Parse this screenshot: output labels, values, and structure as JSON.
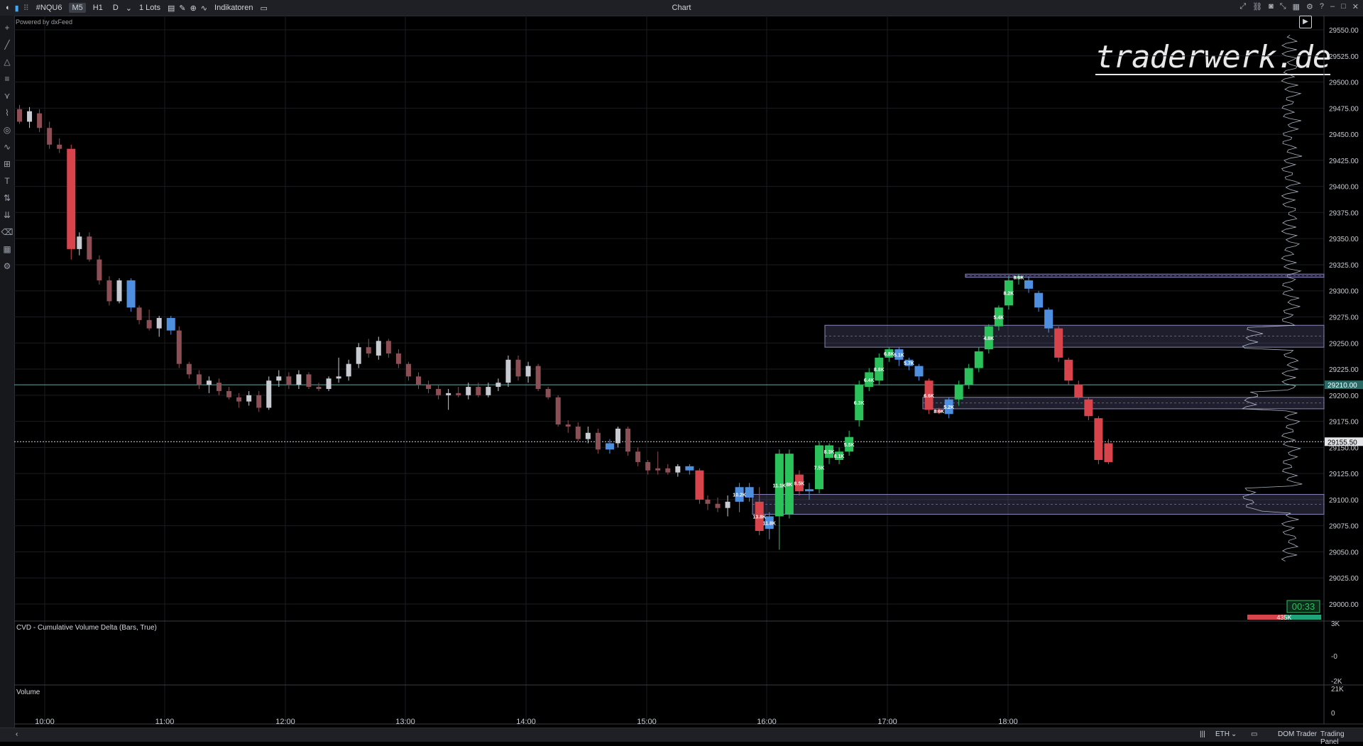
{
  "toolbar": {
    "symbol": "#NQU6",
    "timeframes": [
      "M5",
      "H1",
      "D"
    ],
    "active_timeframe": "M5",
    "lots": "1 Lots",
    "indicators": "Indikatoren",
    "title": "Chart"
  },
  "powered_by": "Powered by dxFeed",
  "watermark": "traderwerk.de",
  "price_axis": {
    "ticks": [
      "29550.00",
      "29525.00",
      "29500.00",
      "29475.00",
      "29450.00",
      "29425.00",
      "29400.00",
      "29375.00",
      "29350.00",
      "29325.00",
      "29300.00",
      "29275.00",
      "29250.00",
      "29225.00",
      "29200.00",
      "29175.00",
      "29150.00",
      "29125.00",
      "29100.00",
      "29075.00",
      "29050.00",
      "29025.00",
      "29000.00"
    ],
    "last_price": "29155.50",
    "marked_price": "29210.00",
    "timer": "00:33",
    "volume_tag": "435K"
  },
  "time_axis": [
    "10:00",
    "11:00",
    "12:00",
    "13:00",
    "14:00",
    "15:00",
    "16:00",
    "17:00",
    "18:00"
  ],
  "cvd_panel": {
    "label": "CVD - Cumulative Volume Delta (Bars, True)",
    "ticks": [
      "3K",
      "-0",
      "-2K"
    ]
  },
  "volume_panel": {
    "label": "Volume",
    "ticks": [
      "21K",
      "0"
    ]
  },
  "bottom_bar": {
    "session": "ETH",
    "dom_trader": "DOM Trader",
    "trading_panel": "Trading Panel"
  },
  "colors": {
    "bull": "#2bc25b",
    "bear": "#d8444b",
    "blue": "#4f8fe0",
    "gray_bull": "#c8ccd2",
    "gray_bear": "#8b4f55",
    "zone": "#6a6690"
  },
  "chart_data": {
    "type": "candlestick",
    "y_range": [
      29000,
      29560
    ],
    "zones": [
      {
        "top": 29316,
        "bottom": 29313
      },
      {
        "top": 29267,
        "bottom": 29246
      },
      {
        "top": 29198,
        "bottom": 29187
      },
      {
        "top": 29105,
        "bottom": 29086
      }
    ],
    "cluster_labels": [
      "8.2K",
      "5.4K",
      "4.8K",
      "8.6K",
      "6.3K",
      "5.5K",
      "5.1K",
      "6.4K",
      "5.2K",
      "6.8K",
      "5.7K",
      "6.6K",
      "8.6K",
      "10.2K",
      "11.1K",
      "8K",
      "8.5K",
      "13.8K",
      "11.8K",
      "8.1K",
      "8.3K",
      "7.5K",
      "8.8K"
    ],
    "candles": [
      {
        "o": 29474,
        "h": 29478,
        "l": 29460,
        "c": 29462,
        "k": "gb"
      },
      {
        "o": 29462,
        "h": 29476,
        "l": 29456,
        "c": 29472,
        "k": "gu"
      },
      {
        "o": 29470,
        "h": 29474,
        "l": 29452,
        "c": 29456,
        "k": "gb"
      },
      {
        "o": 29456,
        "h": 29462,
        "l": 29436,
        "c": 29440,
        "k": "gb"
      },
      {
        "o": 29440,
        "h": 29446,
        "l": 29432,
        "c": 29436,
        "k": "gb"
      },
      {
        "o": 29436,
        "h": 29440,
        "l": 29330,
        "c": 29340,
        "k": "r"
      },
      {
        "o": 29340,
        "h": 29356,
        "l": 29334,
        "c": 29352,
        "k": "gu"
      },
      {
        "o": 29352,
        "h": 29356,
        "l": 29328,
        "c": 29330,
        "k": "gb"
      },
      {
        "o": 29330,
        "h": 29334,
        "l": 29306,
        "c": 29310,
        "k": "gb"
      },
      {
        "o": 29310,
        "h": 29314,
        "l": 29286,
        "c": 29290,
        "k": "gb"
      },
      {
        "o": 29290,
        "h": 29312,
        "l": 29288,
        "c": 29310,
        "k": "gu"
      },
      {
        "o": 29310,
        "h": 29312,
        "l": 29280,
        "c": 29284,
        "k": "b"
      },
      {
        "o": 29284,
        "h": 29286,
        "l": 29268,
        "c": 29272,
        "k": "gb"
      },
      {
        "o": 29272,
        "h": 29282,
        "l": 29262,
        "c": 29264,
        "k": "gb"
      },
      {
        "o": 29264,
        "h": 29276,
        "l": 29256,
        "c": 29274,
        "k": "gu"
      },
      {
        "o": 29274,
        "h": 29276,
        "l": 29258,
        "c": 29262,
        "k": "b"
      },
      {
        "o": 29262,
        "h": 29266,
        "l": 29226,
        "c": 29230,
        "k": "gb"
      },
      {
        "o": 29230,
        "h": 29232,
        "l": 29216,
        "c": 29220,
        "k": "gb"
      },
      {
        "o": 29220,
        "h": 29224,
        "l": 29206,
        "c": 29210,
        "k": "gb"
      },
      {
        "o": 29210,
        "h": 29218,
        "l": 29202,
        "c": 29214,
        "k": "gu"
      },
      {
        "o": 29212,
        "h": 29216,
        "l": 29200,
        "c": 29204,
        "k": "gb"
      },
      {
        "o": 29204,
        "h": 29208,
        "l": 29196,
        "c": 29198,
        "k": "gb"
      },
      {
        "o": 29198,
        "h": 29202,
        "l": 29188,
        "c": 29194,
        "k": "gb"
      },
      {
        "o": 29194,
        "h": 29204,
        "l": 29190,
        "c": 29200,
        "k": "gu"
      },
      {
        "o": 29200,
        "h": 29204,
        "l": 29184,
        "c": 29188,
        "k": "gb"
      },
      {
        "o": 29188,
        "h": 29218,
        "l": 29186,
        "c": 29214,
        "k": "gu"
      },
      {
        "o": 29214,
        "h": 29224,
        "l": 29208,
        "c": 29218,
        "k": "gu"
      },
      {
        "o": 29218,
        "h": 29222,
        "l": 29206,
        "c": 29210,
        "k": "gb"
      },
      {
        "o": 29210,
        "h": 29224,
        "l": 29206,
        "c": 29220,
        "k": "gu"
      },
      {
        "o": 29220,
        "h": 29222,
        "l": 29206,
        "c": 29208,
        "k": "gb"
      },
      {
        "o": 29208,
        "h": 29212,
        "l": 29204,
        "c": 29206,
        "k": "gb"
      },
      {
        "o": 29206,
        "h": 29218,
        "l": 29204,
        "c": 29216,
        "k": "gu"
      },
      {
        "o": 29216,
        "h": 29236,
        "l": 29212,
        "c": 29218,
        "k": "gu"
      },
      {
        "o": 29218,
        "h": 29234,
        "l": 29214,
        "c": 29230,
        "k": "gu"
      },
      {
        "o": 29230,
        "h": 29250,
        "l": 29226,
        "c": 29246,
        "k": "gu"
      },
      {
        "o": 29246,
        "h": 29254,
        "l": 29236,
        "c": 29240,
        "k": "gb"
      },
      {
        "o": 29238,
        "h": 29256,
        "l": 29234,
        "c": 29252,
        "k": "gu"
      },
      {
        "o": 29252,
        "h": 29254,
        "l": 29236,
        "c": 29240,
        "k": "gb"
      },
      {
        "o": 29240,
        "h": 29244,
        "l": 29226,
        "c": 29230,
        "k": "gb"
      },
      {
        "o": 29230,
        "h": 29232,
        "l": 29214,
        "c": 29218,
        "k": "gb"
      },
      {
        "o": 29218,
        "h": 29222,
        "l": 29206,
        "c": 29210,
        "k": "gb"
      },
      {
        "o": 29210,
        "h": 29214,
        "l": 29202,
        "c": 29206,
        "k": "gb"
      },
      {
        "o": 29206,
        "h": 29210,
        "l": 29196,
        "c": 29200,
        "k": "gb"
      },
      {
        "o": 29200,
        "h": 29206,
        "l": 29186,
        "c": 29202,
        "k": "gu"
      },
      {
        "o": 29202,
        "h": 29208,
        "l": 29198,
        "c": 29200,
        "k": "gb"
      },
      {
        "o": 29200,
        "h": 29212,
        "l": 29196,
        "c": 29208,
        "k": "gu"
      },
      {
        "o": 29208,
        "h": 29212,
        "l": 29198,
        "c": 29200,
        "k": "gb"
      },
      {
        "o": 29200,
        "h": 29212,
        "l": 29198,
        "c": 29208,
        "k": "gu"
      },
      {
        "o": 29208,
        "h": 29216,
        "l": 29204,
        "c": 29212,
        "k": "gu"
      },
      {
        "o": 29212,
        "h": 29238,
        "l": 29208,
        "c": 29234,
        "k": "gu"
      },
      {
        "o": 29234,
        "h": 29238,
        "l": 29214,
        "c": 29218,
        "k": "gb"
      },
      {
        "o": 29218,
        "h": 29232,
        "l": 29212,
        "c": 29228,
        "k": "gu"
      },
      {
        "o": 29228,
        "h": 29230,
        "l": 29204,
        "c": 29206,
        "k": "gb"
      },
      {
        "o": 29206,
        "h": 29208,
        "l": 29196,
        "c": 29198,
        "k": "gb"
      },
      {
        "o": 29198,
        "h": 29200,
        "l": 29170,
        "c": 29172,
        "k": "gb"
      },
      {
        "o": 29172,
        "h": 29176,
        "l": 29164,
        "c": 29170,
        "k": "gb"
      },
      {
        "o": 29170,
        "h": 29174,
        "l": 29156,
        "c": 29158,
        "k": "gb"
      },
      {
        "o": 29158,
        "h": 29170,
        "l": 29154,
        "c": 29164,
        "k": "gu"
      },
      {
        "o": 29164,
        "h": 29168,
        "l": 29144,
        "c": 29148,
        "k": "gb"
      },
      {
        "o": 29148,
        "h": 29158,
        "l": 29144,
        "c": 29154,
        "k": "b"
      },
      {
        "o": 29154,
        "h": 29170,
        "l": 29150,
        "c": 29168,
        "k": "gu"
      },
      {
        "o": 29168,
        "h": 29170,
        "l": 29142,
        "c": 29146,
        "k": "gb"
      },
      {
        "o": 29146,
        "h": 29150,
        "l": 29132,
        "c": 29136,
        "k": "gb"
      },
      {
        "o": 29136,
        "h": 29138,
        "l": 29124,
        "c": 29128,
        "k": "gb"
      },
      {
        "o": 29128,
        "h": 29146,
        "l": 29124,
        "c": 29130,
        "k": "gb"
      },
      {
        "o": 29130,
        "h": 29134,
        "l": 29124,
        "c": 29126,
        "k": "gb"
      },
      {
        "o": 29126,
        "h": 29134,
        "l": 29122,
        "c": 29132,
        "k": "gu"
      },
      {
        "o": 29132,
        "h": 29134,
        "l": 29124,
        "c": 29128,
        "k": "b"
      },
      {
        "o": 29128,
        "h": 29130,
        "l": 29096,
        "c": 29100,
        "k": "r"
      },
      {
        "o": 29100,
        "h": 29104,
        "l": 29090,
        "c": 29096,
        "k": "gb"
      },
      {
        "o": 29096,
        "h": 29102,
        "l": 29088,
        "c": 29092,
        "k": "gb"
      },
      {
        "o": 29092,
        "h": 29104,
        "l": 29084,
        "c": 29098,
        "k": "gu"
      },
      {
        "o": 29098,
        "h": 29116,
        "l": 29088,
        "c": 29112,
        "k": "b"
      },
      {
        "o": 29112,
        "h": 29116,
        "l": 29098,
        "c": 29102,
        "k": "b"
      },
      {
        "o": 29098,
        "h": 29112,
        "l": 29066,
        "c": 29070,
        "k": "r"
      },
      {
        "o": 29072,
        "h": 29088,
        "l": 29062,
        "c": 29084,
        "k": "b"
      },
      {
        "o": 29084,
        "h": 29148,
        "l": 29052,
        "c": 29144,
        "k": "g"
      },
      {
        "o": 29144,
        "h": 29148,
        "l": 29082,
        "c": 29086,
        "k": "g"
      },
      {
        "o": 29124,
        "h": 29128,
        "l": 29104,
        "c": 29108,
        "k": "r"
      },
      {
        "o": 29108,
        "h": 29116,
        "l": 29100,
        "c": 29110,
        "k": "b"
      },
      {
        "o": 29110,
        "h": 29156,
        "l": 29106,
        "c": 29152,
        "k": "g"
      },
      {
        "o": 29140,
        "h": 29154,
        "l": 29134,
        "c": 29152,
        "k": "g"
      },
      {
        "o": 29138,
        "h": 29150,
        "l": 29134,
        "c": 29146,
        "k": "g"
      },
      {
        "o": 29146,
        "h": 29166,
        "l": 29142,
        "c": 29160,
        "k": "g"
      },
      {
        "o": 29176,
        "h": 29214,
        "l": 29170,
        "c": 29210,
        "k": "g"
      },
      {
        "o": 29208,
        "h": 29226,
        "l": 29204,
        "c": 29222,
        "k": "g"
      },
      {
        "o": 29214,
        "h": 29240,
        "l": 29210,
        "c": 29236,
        "k": "g"
      },
      {
        "o": 29236,
        "h": 29246,
        "l": 29232,
        "c": 29244,
        "k": "g"
      },
      {
        "o": 29244,
        "h": 29246,
        "l": 29228,
        "c": 29234,
        "k": "b"
      },
      {
        "o": 29234,
        "h": 29236,
        "l": 29224,
        "c": 29228,
        "k": "b"
      },
      {
        "o": 29228,
        "h": 29230,
        "l": 29214,
        "c": 29218,
        "k": "b"
      },
      {
        "o": 29214,
        "h": 29216,
        "l": 29182,
        "c": 29186,
        "k": "r"
      },
      {
        "o": 29186,
        "h": 29188,
        "l": 29182,
        "c": 29184,
        "k": "r"
      },
      {
        "o": 29182,
        "h": 29198,
        "l": 29178,
        "c": 29196,
        "k": "b"
      },
      {
        "o": 29196,
        "h": 29214,
        "l": 29190,
        "c": 29210,
        "k": "g"
      },
      {
        "o": 29210,
        "h": 29230,
        "l": 29206,
        "c": 29226,
        "k": "g"
      },
      {
        "o": 29226,
        "h": 29246,
        "l": 29222,
        "c": 29242,
        "k": "g"
      },
      {
        "o": 29244,
        "h": 29268,
        "l": 29240,
        "c": 29266,
        "k": "g"
      },
      {
        "o": 29266,
        "h": 29286,
        "l": 29262,
        "c": 29284,
        "k": "g"
      },
      {
        "o": 29286,
        "h": 29314,
        "l": 29282,
        "c": 29310,
        "k": "g"
      },
      {
        "o": 29312,
        "h": 29316,
        "l": 29306,
        "c": 29314,
        "k": "g"
      },
      {
        "o": 29310,
        "h": 29314,
        "l": 29298,
        "c": 29302,
        "k": "b"
      },
      {
        "o": 29298,
        "h": 29300,
        "l": 29280,
        "c": 29284,
        "k": "b"
      },
      {
        "o": 29282,
        "h": 29284,
        "l": 29260,
        "c": 29264,
        "k": "b"
      },
      {
        "o": 29264,
        "h": 29266,
        "l": 29232,
        "c": 29236,
        "k": "r"
      },
      {
        "o": 29234,
        "h": 29236,
        "l": 29210,
        "c": 29214,
        "k": "r"
      },
      {
        "o": 29210,
        "h": 29214,
        "l": 29196,
        "c": 29198,
        "k": "r"
      },
      {
        "o": 29196,
        "h": 29198,
        "l": 29176,
        "c": 29180,
        "k": "r"
      },
      {
        "o": 29178,
        "h": 29180,
        "l": 29134,
        "c": 29138,
        "k": "r"
      },
      {
        "o": 29154,
        "h": 29158,
        "l": 29134,
        "c": 29136,
        "k": "r"
      }
    ]
  }
}
